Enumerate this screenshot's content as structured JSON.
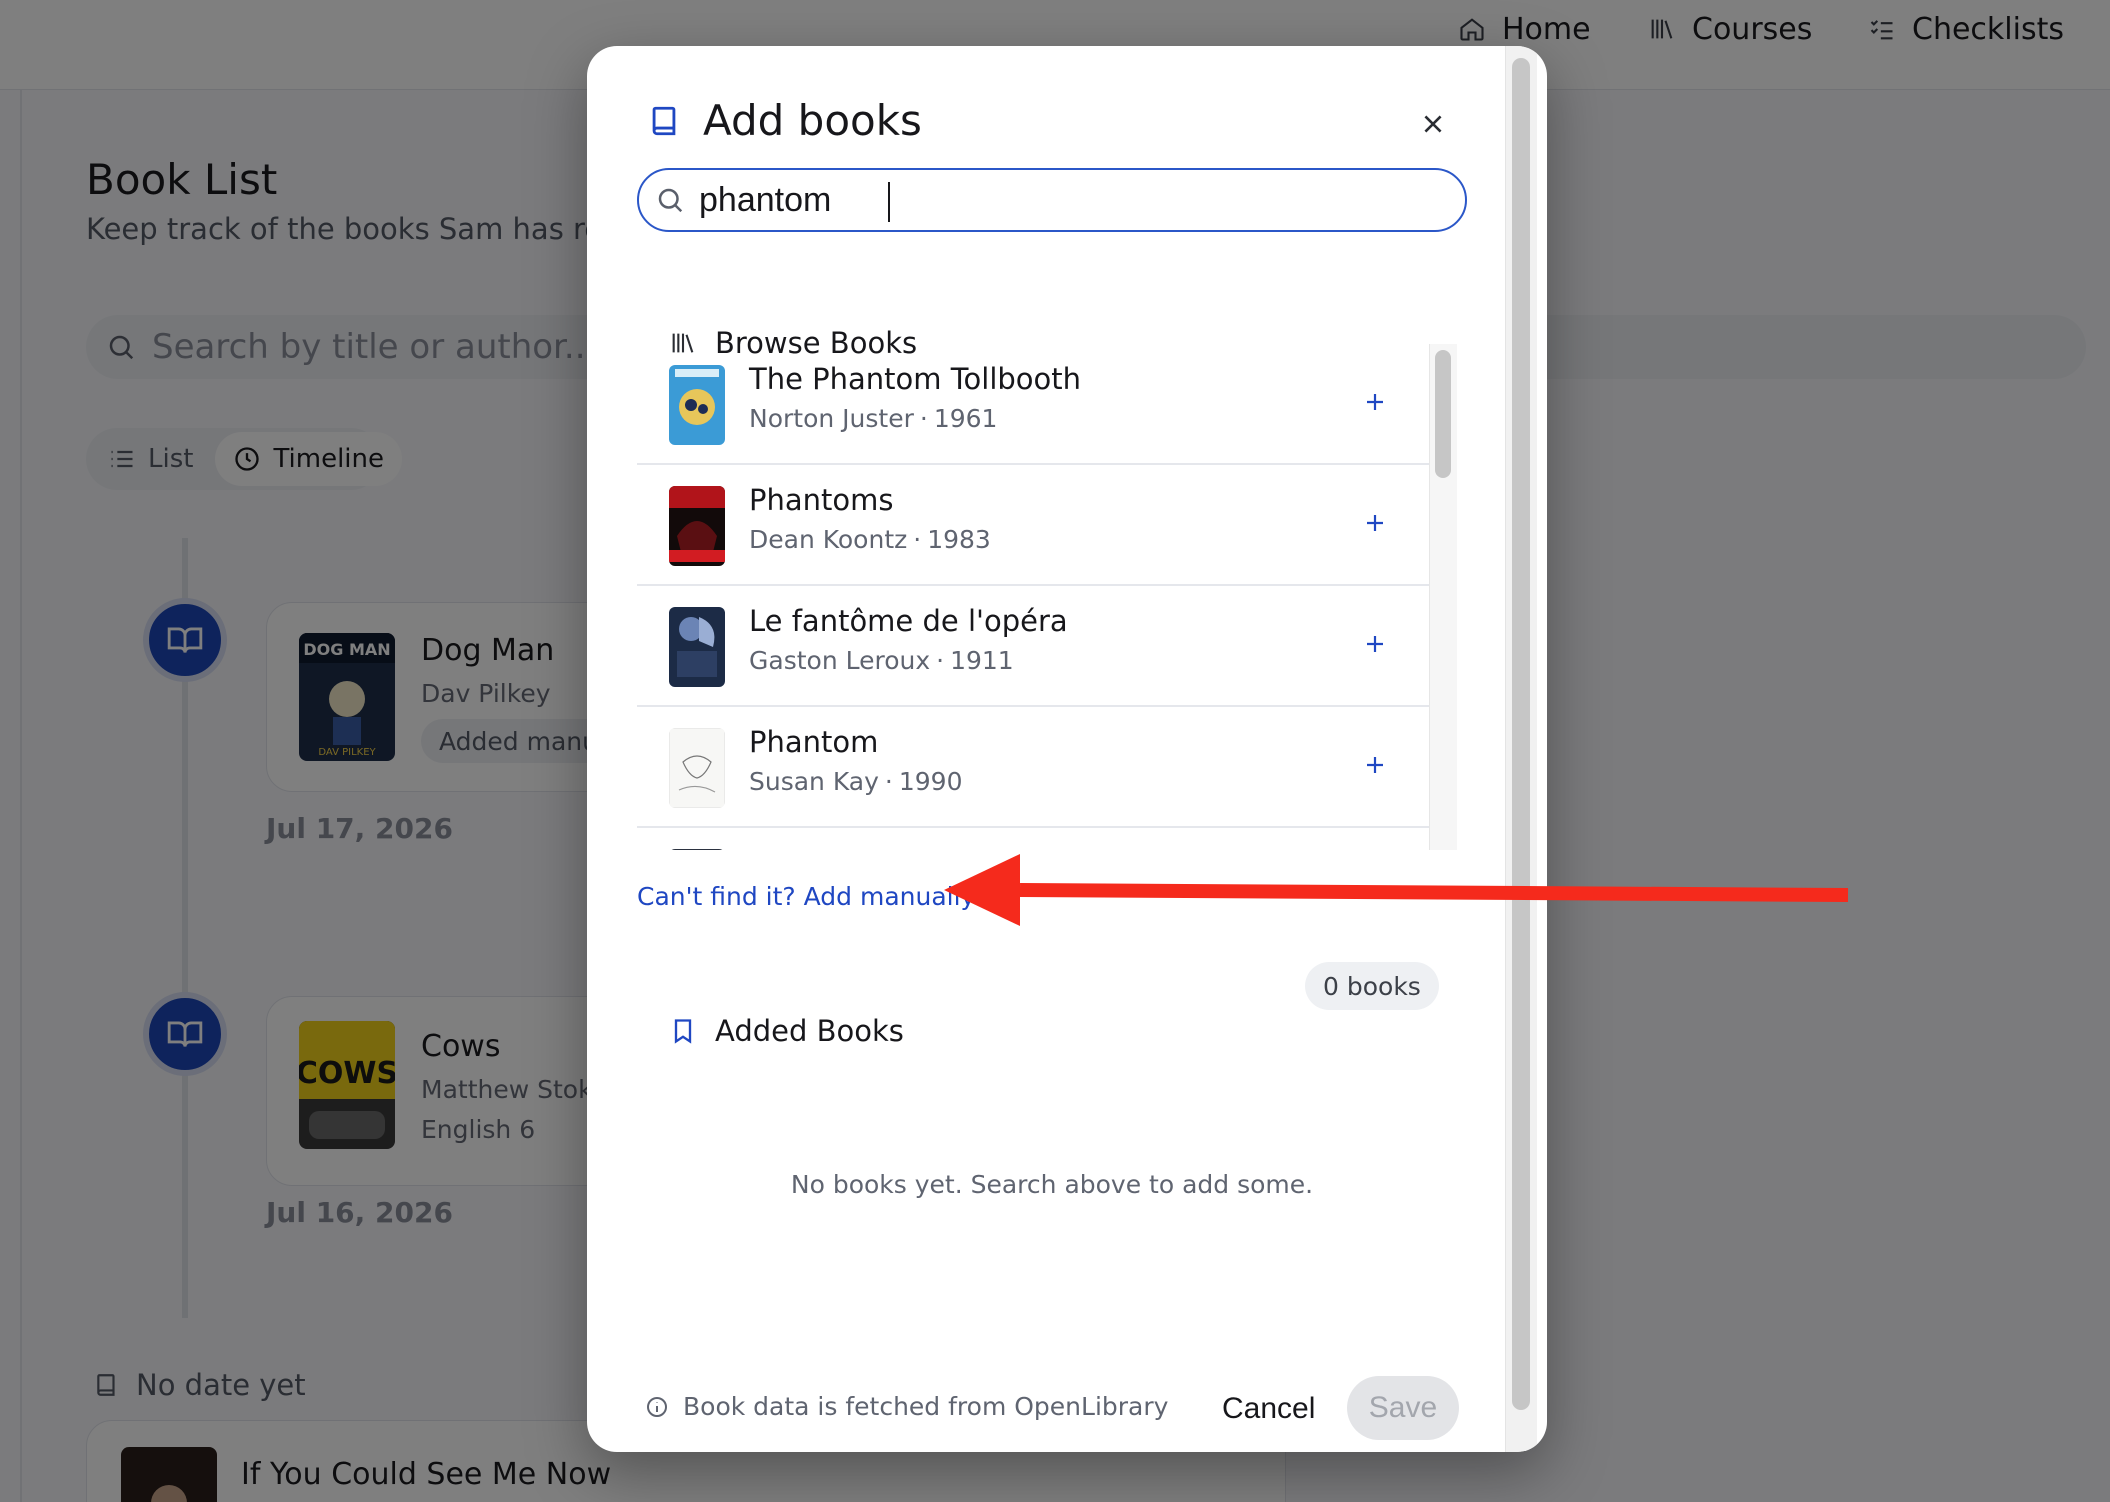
{
  "nav": {
    "home": "Home",
    "courses": "Courses",
    "checklists": "Checklists"
  },
  "page": {
    "title": "Book List",
    "subtitle": "Keep track of the books Sam has read.",
    "search_placeholder": "Search by title or author...",
    "view_list": "List",
    "view_timeline": "Timeline",
    "timeline": [
      {
        "title": "Dog Man",
        "author": "Dav Pilkey",
        "tag": "Added manu",
        "date": "Jul 17, 2026"
      },
      {
        "title": "Cows",
        "author": "Matthew Stoke",
        "course": "English 6",
        "date": "Jul 16, 2026"
      }
    ],
    "no_date_label": "No date yet",
    "undated_title": "If You Could See Me Now"
  },
  "modal": {
    "title": "Add books",
    "search_value": "phantom",
    "browse_title": "Browse Books",
    "results": [
      {
        "title": "The Phantom Tollbooth",
        "author": "Norton Juster",
        "year": "1961"
      },
      {
        "title": "Phantoms",
        "author": "Dean Koontz",
        "year": "1983"
      },
      {
        "title": "Le fantôme de l'opéra",
        "author": "Gaston Leroux",
        "year": "1911"
      },
      {
        "title": "Phantom",
        "author": "Susan Kay",
        "year": "1990"
      }
    ],
    "meta_separator": "·",
    "manual_link": "Can't find it? Add manually",
    "added_title": "Added Books",
    "added_count": "0 books",
    "empty_message": "No books yet. Search above to add some.",
    "footer_note": "Book data is fetched from OpenLibrary",
    "cancel_label": "Cancel",
    "save_label": "Save"
  },
  "colors": {
    "accent": "#1f47c2",
    "timeline_dot": "#1d46b8",
    "annotation_arrow": "#f52a1c",
    "save_disabled_bg": "#e3e4e7"
  }
}
